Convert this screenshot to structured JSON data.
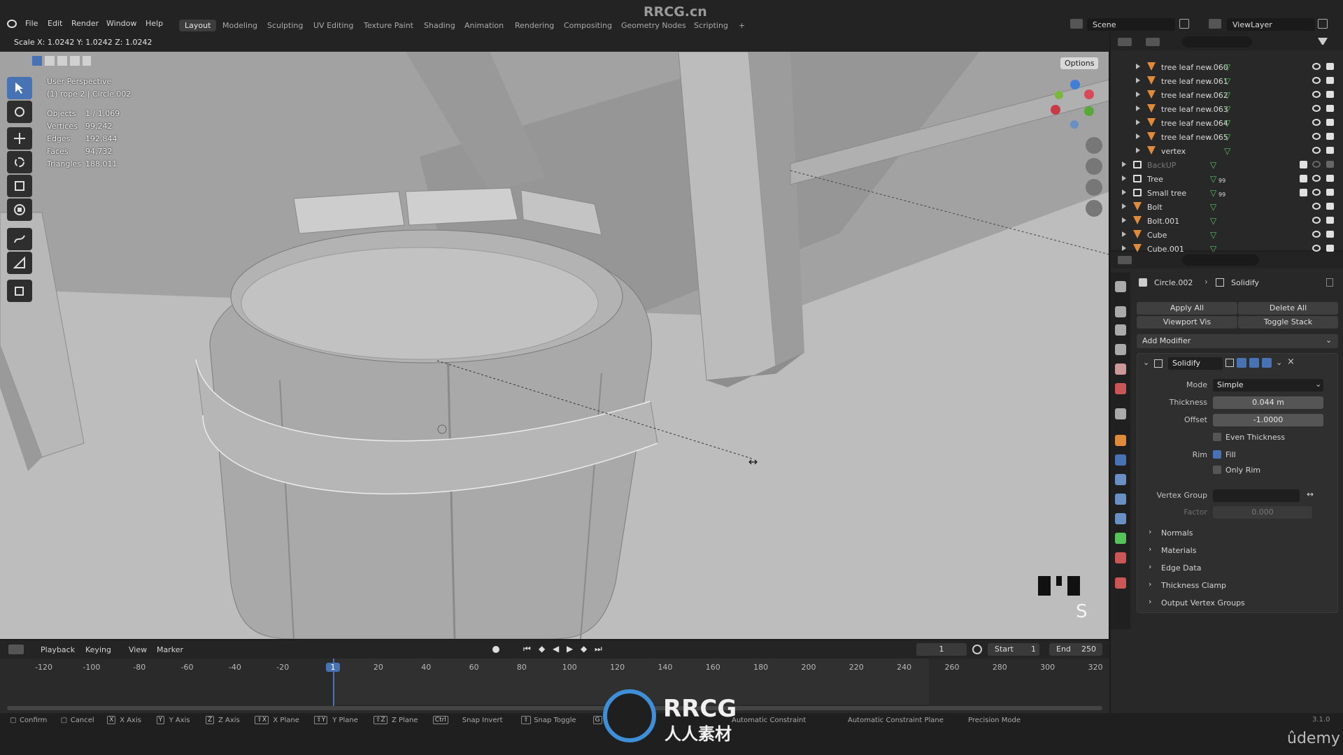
{
  "app": {
    "watermark_title": "RRCG.cn",
    "udemy": "ûdemy",
    "version": "3.1.0"
  },
  "menu": {
    "items": [
      "File",
      "Edit",
      "Render",
      "Window",
      "Help"
    ]
  },
  "workspaces": {
    "tabs": [
      "Layout",
      "Modeling",
      "Sculpting",
      "UV Editing",
      "Texture Paint",
      "Shading",
      "Animation",
      "Rendering",
      "Compositing",
      "Geometry Nodes",
      "Scripting"
    ],
    "add": "+",
    "active": "Layout"
  },
  "scene": {
    "scene_name": "Scene",
    "view_layer": "ViewLayer"
  },
  "header": {
    "scale_readout": "Scale X: 1.0242   Y: 1.0242  Z: 1.0242",
    "options": "Options"
  },
  "viewport": {
    "perspective": "User Perspective",
    "context": "(1) rope 2 | Circle.002",
    "stats": [
      {
        "label": "Objects",
        "value": "1 / 1,069"
      },
      {
        "label": "Vertices",
        "value": "99,242"
      },
      {
        "label": "Edges",
        "value": "192,844"
      },
      {
        "label": "Faces",
        "value": "94,732"
      },
      {
        "label": "Triangles",
        "value": "188,011"
      }
    ],
    "key_hint": "S"
  },
  "outliner": {
    "rows": [
      {
        "name": "tree leaf new.060",
        "indent": 2,
        "type": "object"
      },
      {
        "name": "tree leaf new.061",
        "indent": 2,
        "type": "object"
      },
      {
        "name": "tree leaf new.062",
        "indent": 2,
        "type": "object"
      },
      {
        "name": "tree leaf new.063",
        "indent": 2,
        "type": "object"
      },
      {
        "name": "tree leaf new.064",
        "indent": 2,
        "type": "object"
      },
      {
        "name": "tree leaf new.065",
        "indent": 2,
        "type": "object"
      },
      {
        "name": "vertex",
        "indent": 2,
        "type": "object"
      },
      {
        "name": "BackUP",
        "indent": 1,
        "type": "collection",
        "dim": true
      },
      {
        "name": "Tree",
        "indent": 1,
        "type": "collection",
        "badge": "99"
      },
      {
        "name": "Small tree",
        "indent": 1,
        "type": "collection",
        "badge": "99"
      },
      {
        "name": "Bolt",
        "indent": 1,
        "type": "object"
      },
      {
        "name": "Bolt.001",
        "indent": 1,
        "type": "object"
      },
      {
        "name": "Cube",
        "indent": 1,
        "type": "object"
      },
      {
        "name": "Cube.001",
        "indent": 1,
        "type": "object"
      }
    ]
  },
  "properties": {
    "breadcrumb_object": "Circle.002",
    "breadcrumb_modifier": "Solidify",
    "apply_all": "Apply All",
    "delete_all": "Delete All",
    "viewport_vis": "Viewport Vis",
    "toggle_stack": "Toggle Stack",
    "add_modifier": "Add Modifier",
    "modifier": {
      "name": "Solidify",
      "mode_label": "Mode",
      "mode_value": "Simple",
      "thickness_label": "Thickness",
      "thickness_value": "0.044 m",
      "offset_label": "Offset",
      "offset_value": "-1.0000",
      "even_thickness": "Even Thickness",
      "rim_label": "Rim",
      "fill": "Fill",
      "only_rim": "Only Rim",
      "vertex_group_label": "Vertex Group",
      "factor_label": "Factor",
      "factor_value": "0.000",
      "subpanels": [
        "Normals",
        "Materials",
        "Edge Data",
        "Thickness Clamp",
        "Output Vertex Groups"
      ]
    }
  },
  "timeline": {
    "menus": [
      "Playback",
      "Keying",
      "View",
      "Marker"
    ],
    "current_frame": "1",
    "start_label": "Start",
    "start_value": "1",
    "end_label": "End",
    "end_value": "250",
    "ticks": [
      "-120",
      "-100",
      "-80",
      "-60",
      "-40",
      "-20",
      "1",
      "20",
      "40",
      "60",
      "80",
      "100",
      "120",
      "140",
      "160",
      "180",
      "200",
      "220",
      "240",
      "260",
      "280",
      "300",
      "320"
    ]
  },
  "statusbar": {
    "items": [
      {
        "key": "",
        "label": "Confirm"
      },
      {
        "key": "",
        "label": "Cancel"
      },
      {
        "key": "X",
        "label": "X Axis"
      },
      {
        "key": "Y",
        "label": "Y Axis"
      },
      {
        "key": "Z",
        "label": "Z Axis"
      },
      {
        "key": "⇧X",
        "label": "X Plane"
      },
      {
        "key": "⇧Y",
        "label": "Y Plane"
      },
      {
        "key": "⇧Z",
        "label": "Z Plane"
      },
      {
        "key": "Ctrl",
        "label": "Snap Invert"
      },
      {
        "key": "⇧",
        "label": "Snap Toggle"
      },
      {
        "key": "G",
        "label": ""
      }
    ],
    "right_items": [
      "Automatic Constraint",
      "Automatic Constraint Plane",
      "Precision Mode"
    ]
  },
  "logo": {
    "brand": "RRCG",
    "sub": "人人素材"
  }
}
